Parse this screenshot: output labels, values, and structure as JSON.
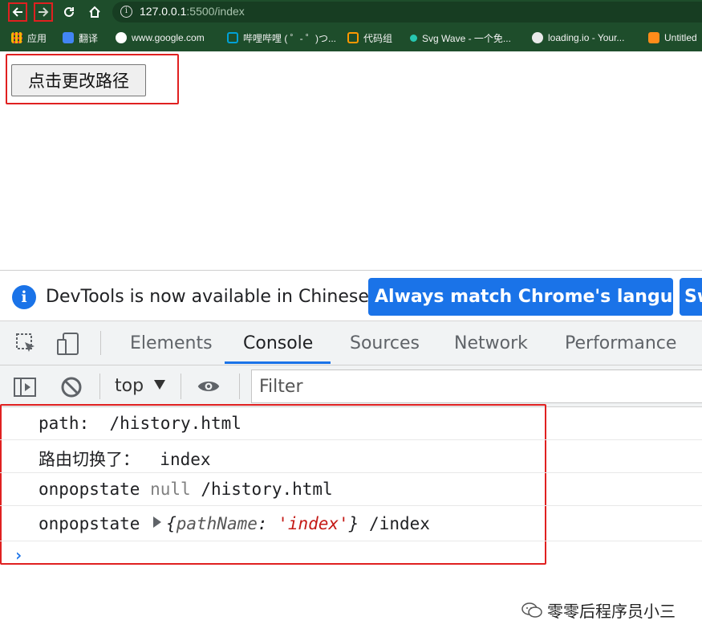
{
  "browser": {
    "url_host": "127.0.0.1",
    "url_path": ":5500/index",
    "bookmarks": [
      {
        "label": "应用",
        "color": "#f4b400"
      },
      {
        "label": "翻译",
        "color": "#4285f4"
      },
      {
        "label": "www.google.com",
        "color": "#ffffff"
      },
      {
        "label": "哔哩哔哩 ( ゜- ゜)つ...",
        "color": "#00a1d6"
      },
      {
        "label": "代码组",
        "color": "#ff9800"
      },
      {
        "label": "Svg Wave - 一个免...",
        "color": "#27c7b0"
      },
      {
        "label": "loading.io - Your...",
        "color": "#e9e9e9"
      },
      {
        "label": "Untitled",
        "color": "#ff8c1a"
      }
    ]
  },
  "page": {
    "button_label": "点击更改路径"
  },
  "devtools": {
    "infobar_text": "DevTools is now available in Chinese!",
    "lang_button": "Always match Chrome's language",
    "lang_button2": "Sw",
    "tabs": [
      "Elements",
      "Console",
      "Sources",
      "Network",
      "Performance"
    ],
    "active_tab": "Console",
    "context": "top",
    "filter_placeholder": "Filter",
    "console_rows": {
      "r1_label": "path:",
      "r1_value": "/history.html",
      "r2_label": "路由切换了：",
      "r2_value": "index",
      "r3_label": "onpopstate",
      "r3_null": "null",
      "r3_value": "/history.html",
      "r4_label": "onpopstate",
      "r4_key": "pathName",
      "r4_str": "'index'",
      "r4_value": "/index"
    },
    "prompt": "›"
  },
  "watermark": "零零后程序员小三"
}
